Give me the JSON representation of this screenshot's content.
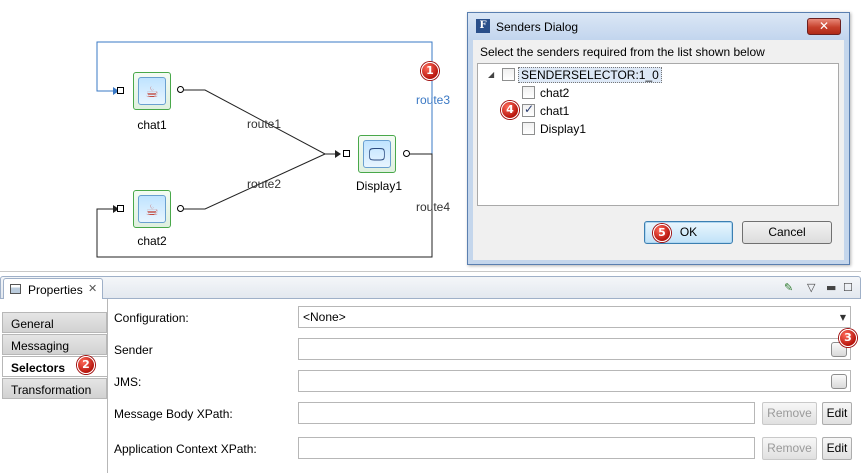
{
  "diagram": {
    "nodes": {
      "chat1": {
        "label": "chat1"
      },
      "chat2": {
        "label": "chat2"
      },
      "display1": {
        "label": "Display1"
      }
    },
    "routes": {
      "route1": "route1",
      "route2": "route2",
      "route3": "route3",
      "route4": "route4"
    },
    "colors": {
      "node_border": "#49a84a",
      "selected_route": "#3a78c4",
      "badge": "#c8201a"
    }
  },
  "badges": {
    "b1": "1",
    "b2": "2",
    "b3": "3",
    "b4": "4",
    "b5": "5"
  },
  "dialog": {
    "app_icon": "F",
    "title": "Senders Dialog",
    "close_label": "✕",
    "prompt": "Select the senders required from the list shown below",
    "tree": {
      "root": {
        "label": "SENDERSELECTOR:1_0",
        "checked": false,
        "expanded": true
      },
      "children": [
        {
          "label": "chat2",
          "checked": false
        },
        {
          "label": "chat1",
          "checked": true
        },
        {
          "label": "Display1",
          "checked": false
        }
      ]
    },
    "ok_label": "OK",
    "cancel_label": "Cancel"
  },
  "properties": {
    "tab_label": "Properties",
    "tab_close": "✕",
    "toolbar_icons": [
      "pin-icon",
      "view-menu-icon",
      "minimize-icon",
      "maximize-icon"
    ],
    "sidebar_tabs": [
      "General",
      "Messaging",
      "Selectors",
      "Transformation"
    ],
    "active_tab": "Selectors",
    "fields": {
      "configuration_label": "Configuration:",
      "configuration_value": "<None>",
      "sender_label": "Sender",
      "sender_value": "",
      "jms_label": "JMS:",
      "jms_value": "",
      "message_body_label": "Message Body XPath:",
      "message_body_value": "",
      "app_context_label": "Application Context XPath:",
      "app_context_value": ""
    },
    "remove_label": "Remove",
    "edit_label": "Edit"
  }
}
